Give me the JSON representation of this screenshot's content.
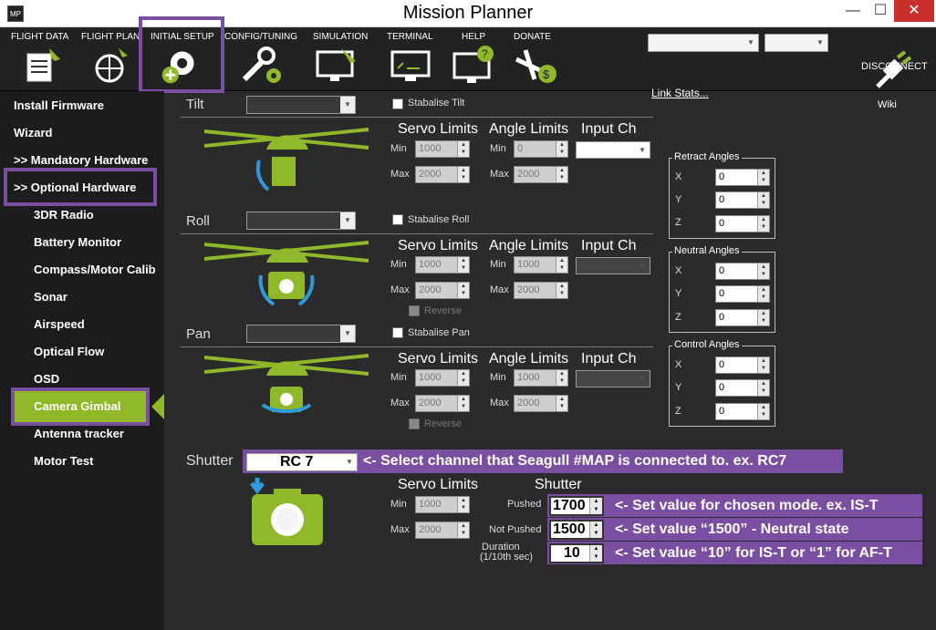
{
  "window": {
    "title": "Mission Planner",
    "app_icon": "MP",
    "minimize": "—",
    "maximize": "☐",
    "close": "✕"
  },
  "menu": {
    "items": [
      {
        "label": "FLIGHT DATA",
        "icon": "flight-data-icon"
      },
      {
        "label": "FLIGHT PLAN",
        "icon": "flight-plan-icon"
      },
      {
        "label": "INITIAL SETUP",
        "icon": "initial-setup-icon"
      },
      {
        "label": "CONFIG/TUNING",
        "icon": "config-tuning-icon"
      },
      {
        "label": "SIMULATION",
        "icon": "simulation-icon"
      },
      {
        "label": "TERMINAL",
        "icon": "terminal-icon"
      },
      {
        "label": "HELP",
        "icon": "help-icon"
      },
      {
        "label": "DONATE",
        "icon": "donate-icon"
      }
    ],
    "link_stats": "Link Stats...",
    "disconnect": "DISCONNECT"
  },
  "sidebar": {
    "install_firmware": "Install Firmware",
    "wizard": "Wizard",
    "mandatory": ">> Mandatory Hardware",
    "optional": ">> Optional Hardware",
    "items": [
      "3DR Radio",
      "Battery Monitor",
      "Compass/Motor Calib",
      "Sonar",
      "Airspeed",
      "Optical Flow",
      "OSD",
      "Camera Gimbal",
      "Antenna tracker",
      "Motor Test"
    ]
  },
  "gimbal": {
    "wiki": "Wiki",
    "servo_limits": "Servo Limits",
    "angle_limits": "Angle Limits",
    "input_ch": "Input Ch",
    "min": "Min",
    "max": "Max",
    "reverse": "Reverse",
    "tilt": {
      "label": "Tilt",
      "stabilise": "Stabalise Tilt",
      "servo_min": "1000",
      "servo_max": "2000",
      "angle_min": "0",
      "angle_max": "2000"
    },
    "roll": {
      "label": "Roll",
      "stabilise": "Stabalise Roll",
      "servo_min": "1000",
      "servo_max": "2000",
      "angle_min": "1000",
      "angle_max": "2000"
    },
    "pan": {
      "label": "Pan",
      "stabilise": "Stabalise Pan",
      "servo_min": "1000",
      "servo_max": "2000",
      "angle_min": "1000",
      "angle_max": "2000"
    },
    "retract": {
      "title": "Retract Angles",
      "x": "0",
      "y": "0",
      "z": "0"
    },
    "neutral": {
      "title": "Neutral Angles",
      "x": "0",
      "y": "0",
      "z": "0"
    },
    "control": {
      "title": "Control Angles",
      "x": "0",
      "y": "0",
      "z": "0"
    },
    "axis_x": "X",
    "axis_y": "Y",
    "axis_z": "Z"
  },
  "shutter": {
    "label": "Shutter",
    "channel": "RC 7",
    "channel_note": "<- Select channel that Seagull #MAP is connected to. ex. RC7",
    "servo_limits": "Servo Limits",
    "title": "Shutter",
    "servo_min": "1000",
    "servo_max": "2000",
    "pushed_label": "Pushed",
    "pushed": "1700",
    "pushed_note": "<- Set value for chosen mode. ex. IS-T",
    "not_pushed_label": "Not Pushed",
    "not_pushed": "1500",
    "not_pushed_note": "<- Set value “1500” - Neutral state",
    "duration_label": "Duration",
    "duration_unit": "(1/10th sec)",
    "duration": "10",
    "duration_note": "<- Set value “10” for IS-T or “1” for AF-T"
  }
}
